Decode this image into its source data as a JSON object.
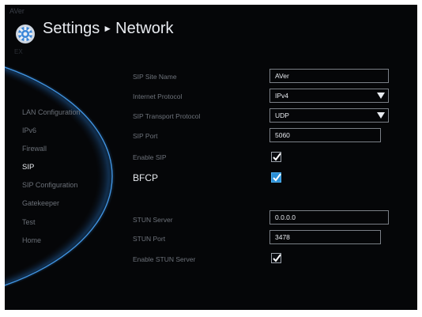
{
  "header": {
    "brand": "AVer",
    "brand_sub": "EX",
    "title": "Settings",
    "separator": "►",
    "subtitle": "Network",
    "icon": "gear-icon"
  },
  "sidebar": {
    "items": [
      {
        "label": "LAN Configuration",
        "active": false
      },
      {
        "label": "IPv6",
        "active": false
      },
      {
        "label": "Firewall",
        "active": false
      },
      {
        "label": "SIP",
        "active": true
      },
      {
        "label": "SIP Configuration",
        "active": false
      },
      {
        "label": "Gatekeeper",
        "active": false
      },
      {
        "label": "Test",
        "active": false
      },
      {
        "label": "Home",
        "active": false
      }
    ]
  },
  "form": {
    "sip_site_name": {
      "label": "SIP Site Name",
      "value": "AVer"
    },
    "internet_protocol": {
      "label": "Internet Protocol",
      "value": "IPv4"
    },
    "sip_transport_protocol": {
      "label": "SIP Transport Protocol",
      "value": "UDP"
    },
    "sip_port": {
      "label": "SIP Port",
      "value": "5060"
    },
    "enable_sip": {
      "label": "Enable SIP",
      "checked": true
    },
    "bfcp": {
      "label": "BFCP",
      "checked": true
    },
    "stun_server": {
      "label": "STUN Server",
      "value": "0.0.0.0"
    },
    "stun_port": {
      "label": "STUN Port",
      "value": "3478"
    },
    "enable_stun_server": {
      "label": "Enable STUN Server",
      "checked": true
    }
  },
  "colors": {
    "background": "#050608",
    "accent_blue": "#2b8fd6",
    "arc_glow": "#4aa8ff",
    "text_dim": "#6e737b",
    "text_bright": "#e8ebf0"
  }
}
